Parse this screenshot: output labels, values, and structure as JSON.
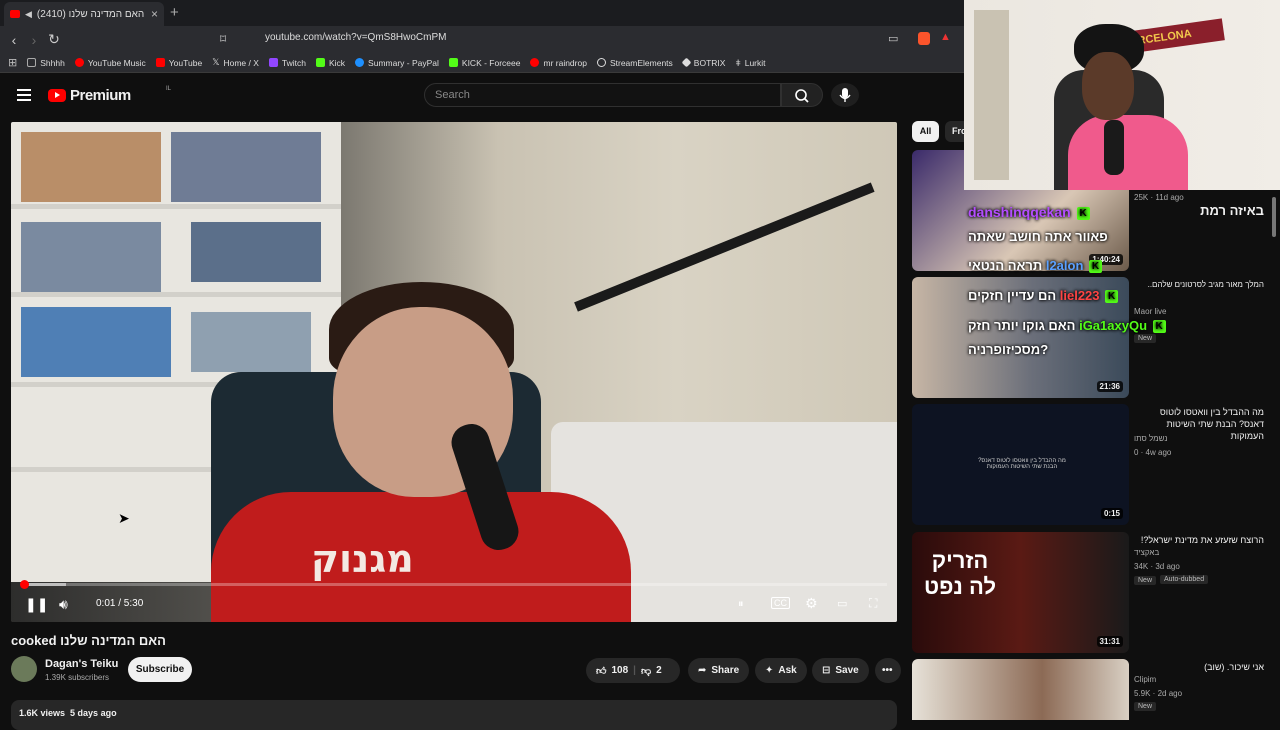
{
  "browser": {
    "tab_title": "(2410) האם המדינה שלנו cooked - YouTube",
    "url": "youtube.com/watch?v=QmS8HwoCmPM",
    "bookmarks": [
      {
        "label": "Shhhh",
        "color": "#888888"
      },
      {
        "label": "YouTube Music",
        "color": "#ff0000"
      },
      {
        "label": "YouTube",
        "color": "#ff0000"
      },
      {
        "label": "Home / X",
        "color": "#ffffff"
      },
      {
        "label": "Twitch",
        "color": "#9146ff"
      },
      {
        "label": "Kick",
        "color": "#53fc18"
      },
      {
        "label": "Summary - PayPal",
        "color": "#1e90ff"
      },
      {
        "label": "KICK - Forceee",
        "color": "#53fc18"
      },
      {
        "label": "mr raindrop",
        "color": "#ff0000"
      },
      {
        "label": "StreamElements",
        "color": "#ffffff"
      },
      {
        "label": "BOTRIX",
        "color": "#dddddd"
      },
      {
        "label": "Lurkit",
        "color": "#dddddd"
      }
    ]
  },
  "youtube": {
    "logo_text": "Premium",
    "logo_region": "IL",
    "search_placeholder": "Search"
  },
  "player": {
    "time": "0:01 / 5:30",
    "progress_fraction": 0.003,
    "shirt_text": "מגנוק"
  },
  "video": {
    "title": "האם המדינה שלנו cooked",
    "channel": "Dagan's Teiku",
    "subscribers": "1.39K subscribers",
    "subscribe_label": "Subscribe",
    "likes": "108",
    "dislikes": "2",
    "share_label": "Share",
    "ask_label": "Ask",
    "save_label": "Save",
    "views": "1.6K views",
    "age": "5 days ago"
  },
  "filters": {
    "all": "All",
    "from": "Fro"
  },
  "recommendations": [
    {
      "title": "באיזה רמת",
      "meta": "25K · 11d ago",
      "duration": "1:40:24"
    },
    {
      "title": "המלך מאור מגיב לסרטונים שלהם..",
      "channel": "Maor live",
      "badge": "New",
      "duration": "21:36"
    },
    {
      "title": "מה ההבדל בין וואטסו לוטוס דאנס? הבנת שתי השיטות העמוקות",
      "channel": "נשמל סתו",
      "meta": "0 · 4w ago",
      "duration": "0:15",
      "thumb_text": "מה ההבדל בין וואטסו לוטוס דאנס? הבנת שתי השיטות העמוקות"
    },
    {
      "title": "הרוצח שזעזע את מדינת ישראל?!",
      "channel": "באקציד",
      "meta": "34K · 3d ago",
      "badge": "New",
      "badge2": "Auto-dubbed",
      "duration": "31:31",
      "thumb_text": "הזריק לה נפט"
    },
    {
      "title": "אני שיכור. (שוב)",
      "channel": "Clipim",
      "meta": "5.9K · 2d ago",
      "badge": "New"
    }
  ],
  "chat": [
    {
      "name": "danshinqqekan",
      "text": "פאוור אתה חושב שאתה",
      "color": "#b44cff"
    },
    {
      "name": "l2alon",
      "text": "תראה הנטאי",
      "color": "#5aa0ff"
    },
    {
      "name": "liel223",
      "text": "הם עדיין חזקים",
      "color": "#ff4444"
    },
    {
      "name": "iGa1axyQu",
      "text": "האם גוקו יותר חזק",
      "color": "#53fc18"
    },
    {
      "text": "?מסכיזופרניה",
      "color": "#ffffff"
    }
  ]
}
